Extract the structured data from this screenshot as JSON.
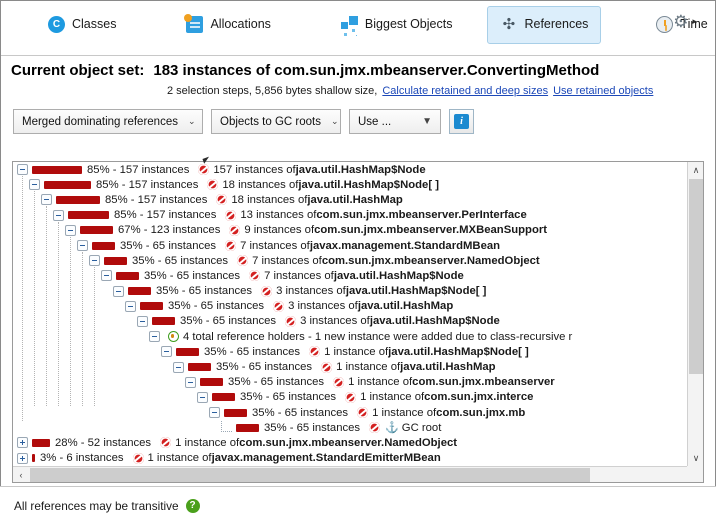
{
  "tabs": [
    {
      "label": "Classes",
      "icon": "classes-icon",
      "selected": false
    },
    {
      "label": "Allocations",
      "icon": "allocations-icon",
      "selected": false
    },
    {
      "label": "Biggest Objects",
      "icon": "biggest-objects-icon",
      "selected": false
    },
    {
      "label": "References",
      "icon": "references-icon",
      "selected": true
    },
    {
      "label": "Time",
      "icon": "time-icon",
      "selected": false
    }
  ],
  "tabbar": {
    "gear_icon": "gear-icon",
    "overflow_arrow": "▸"
  },
  "object_set": {
    "label": "Current object set:",
    "value": "183 instances of com.sun.jmx.mbeanserver.ConvertingMethod",
    "details": "2 selection steps, 5,856 bytes shallow size,",
    "link_calculate": "Calculate retained and deep sizes",
    "link_use_retained": "Use retained objects"
  },
  "toolbar": {
    "mode_select": "Merged dominating references",
    "direction_select": "Objects to GC roots",
    "use_button": "Use ...",
    "info_button": "info-icon",
    "caret": "⌄",
    "solid_caret": "▼"
  },
  "colors": {
    "bar": "#b00b0b",
    "selected_tab_bg": "#dceefb",
    "selected_tab_border": "#a8cfe8",
    "link": "#1c48b8",
    "red_icon": "#d42020",
    "green_icon": "#3f9e1f",
    "help_green": "#4aa01c"
  },
  "tree": {
    "rows": [
      {
        "depth": 0,
        "expander": "minus",
        "bar": 50,
        "pct": "85% - 157 instances",
        "icon": "reference-icon",
        "count": "157 instances of ",
        "cls": "java.util.HashMap$Node"
      },
      {
        "depth": 1,
        "expander": "minus",
        "bar": 47,
        "pct": "85% - 157 instances",
        "icon": "reference-icon",
        "count": "18 instances of ",
        "cls": "java.util.HashMap$Node[ ]"
      },
      {
        "depth": 2,
        "expander": "minus",
        "bar": 44,
        "pct": "85% - 157 instances",
        "icon": "reference-icon",
        "count": "18 instances of ",
        "cls": "java.util.HashMap"
      },
      {
        "depth": 3,
        "expander": "minus",
        "bar": 41,
        "pct": "85% - 157 instances",
        "icon": "reference-icon",
        "count": "13 instances of ",
        "cls": "com.sun.jmx.mbeanserver.PerInterface"
      },
      {
        "depth": 4,
        "expander": "minus",
        "bar": 33,
        "pct": "67% - 123 instances",
        "icon": "reference-icon",
        "count": "9 instances of ",
        "cls": "com.sun.jmx.mbeanserver.MXBeanSupport"
      },
      {
        "depth": 5,
        "expander": "minus",
        "bar": 23,
        "pct": "35% - 65 instances",
        "icon": "reference-icon",
        "count": "7 instances of ",
        "cls": "javax.management.StandardMBean"
      },
      {
        "depth": 6,
        "expander": "minus",
        "bar": 23,
        "pct": "35% - 65 instances",
        "icon": "reference-icon",
        "count": "7 instances of ",
        "cls": "com.sun.jmx.mbeanserver.NamedObject"
      },
      {
        "depth": 7,
        "expander": "minus",
        "bar": 23,
        "pct": "35% - 65 instances",
        "icon": "reference-icon",
        "count": "7 instances of ",
        "cls": "java.util.HashMap$Node"
      },
      {
        "depth": 8,
        "expander": "minus",
        "bar": 23,
        "pct": "35% - 65 instances",
        "icon": "reference-icon",
        "count": "3 instances of ",
        "cls": "java.util.HashMap$Node[ ]"
      },
      {
        "depth": 9,
        "expander": "minus",
        "bar": 23,
        "pct": "35% - 65 instances",
        "icon": "reference-icon",
        "count": "3 instances of ",
        "cls": "java.util.HashMap"
      },
      {
        "depth": 10,
        "expander": "minus",
        "bar": 23,
        "pct": "35% - 65 instances",
        "icon": "reference-icon",
        "count": "3 instances of ",
        "cls": "java.util.HashMap$Node"
      },
      {
        "depth": 11,
        "expander": "minus",
        "bar": 0,
        "pct": "",
        "icon": "reference-holders-icon",
        "count": "4 total reference holders - 1 new instance were added due to class-recursive r",
        "cls": ""
      },
      {
        "depth": 12,
        "expander": "minus",
        "bar": 23,
        "pct": "35% - 65 instances",
        "icon": "reference-icon",
        "count": "1 instance of ",
        "cls": "java.util.HashMap$Node[ ]"
      },
      {
        "depth": 13,
        "expander": "minus",
        "bar": 23,
        "pct": "35% - 65 instances",
        "icon": "reference-icon",
        "count": "1 instance of ",
        "cls": "java.util.HashMap"
      },
      {
        "depth": 14,
        "expander": "minus",
        "bar": 23,
        "pct": "35% - 65 instances",
        "icon": "reference-icon",
        "count": "1 instance of ",
        "cls": "com.sun.jmx.mbeanserver"
      },
      {
        "depth": 15,
        "expander": "minus",
        "bar": 23,
        "pct": "35% - 65 instances",
        "icon": "reference-icon",
        "count": "1 instance of ",
        "cls": "com.sun.jmx.interce"
      },
      {
        "depth": 16,
        "expander": "minus",
        "bar": 23,
        "pct": "35% - 65 instances",
        "icon": "reference-icon",
        "count": "1 instance of ",
        "cls": "com.sun.jmx.mb"
      },
      {
        "depth": 17,
        "expander": "leaf",
        "bar": 23,
        "pct": "35% - 65 instances",
        "icon": "gc-root-icon",
        "count": "GC root",
        "cls": ""
      },
      {
        "depth": 0,
        "expander": "plus",
        "bar": 18,
        "pct": "28% - 52 instances",
        "icon": "reference-icon",
        "count": "1 instance of ",
        "cls": "com.sun.jmx.mbeanserver.NamedObject"
      },
      {
        "depth": 0,
        "expander": "plus",
        "bar": 3,
        "pct": "3% - 6 instances",
        "icon": "reference-icon",
        "count": "1 instance of ",
        "cls": "javax.management.StandardEmitterMBean"
      }
    ],
    "scroll": {
      "up_arrow": "∧",
      "down_arrow": "∨",
      "left_arrow": "‹",
      "right_arrow": "›"
    }
  },
  "status": {
    "text": "All references may be transitive",
    "help_icon": "help-icon",
    "help_glyph": "?"
  }
}
